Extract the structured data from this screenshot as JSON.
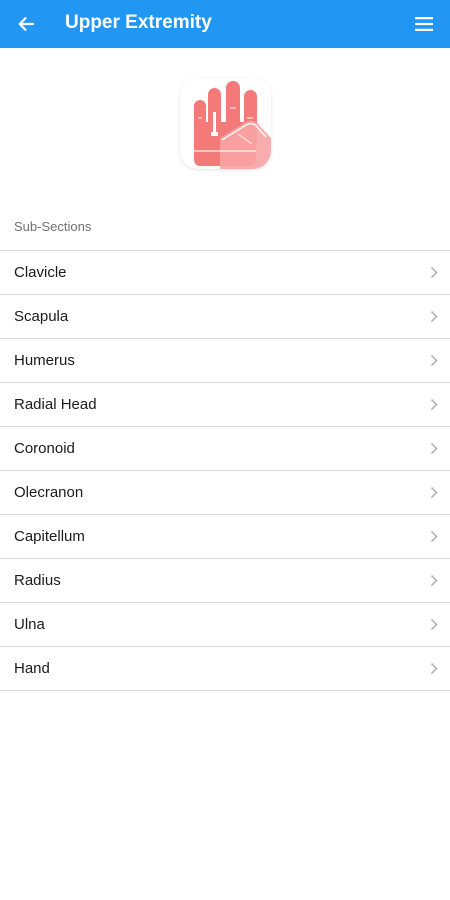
{
  "header": {
    "title": "Upper Extremity",
    "back_icon": "arrow-left-icon",
    "menu_icon": "hamburger-menu-icon",
    "background_color": "#2196f3"
  },
  "logo": {
    "icon": "hand-icon",
    "color": "#f47a7a"
  },
  "section": {
    "title": "Sub-Sections",
    "items": [
      {
        "label": "Clavicle"
      },
      {
        "label": "Scapula"
      },
      {
        "label": "Humerus"
      },
      {
        "label": "Radial Head"
      },
      {
        "label": "Coronoid"
      },
      {
        "label": "Olecranon"
      },
      {
        "label": "Capitellum"
      },
      {
        "label": "Radius"
      },
      {
        "label": "Ulna"
      },
      {
        "label": "Hand"
      }
    ]
  }
}
